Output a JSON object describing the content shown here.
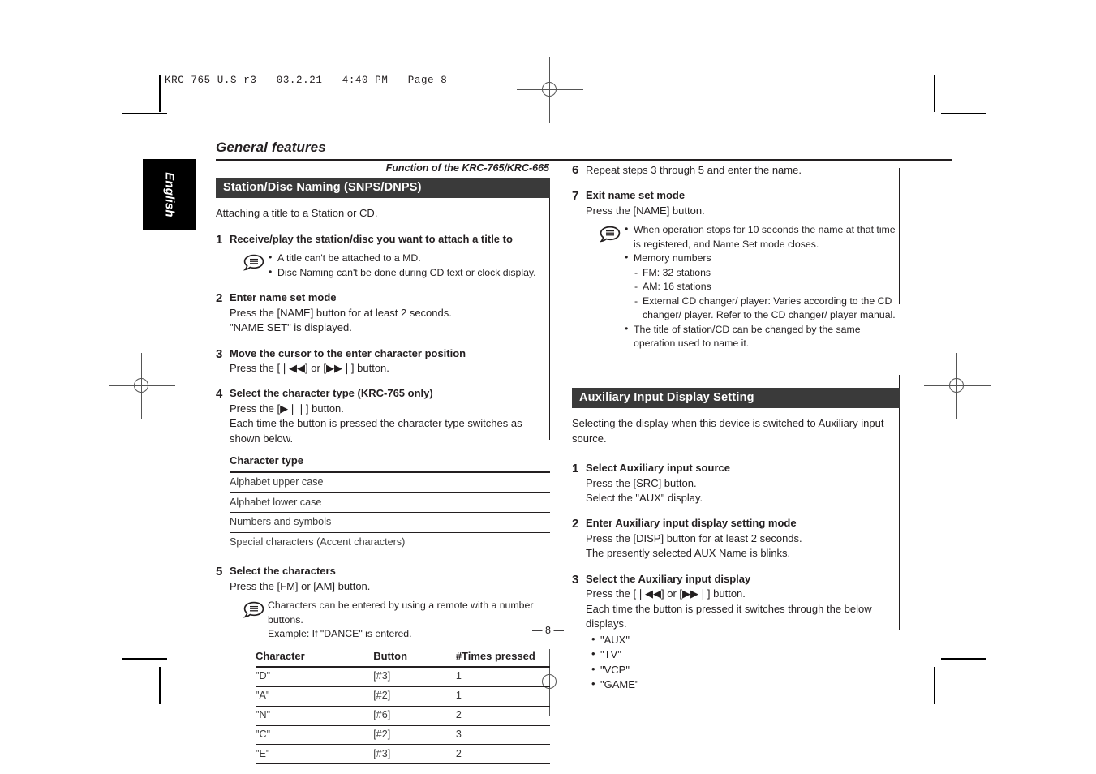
{
  "print_header": "KRC-765_U.S_r3   03.2.21   4:40 PM   Page 8",
  "side_tab": {
    "label": "English"
  },
  "doc_title": "General features",
  "function_note": "Function of the KRC-765/KRC-665",
  "page_number": "— 8 —",
  "icons": {
    "note": "note-speech-bubble-icon"
  },
  "section_naming": {
    "heading": "Station/Disc Naming (SNPS/DNPS)",
    "lead": "Attaching a title to a Station or CD.",
    "steps": [
      {
        "num": "1",
        "heading": "Receive/play the station/disc you want to attach a title to",
        "lines": [],
        "note_bullets": [
          "A title can't be attached to a MD.",
          "Disc Naming can't be done during CD text or clock display."
        ]
      },
      {
        "num": "2",
        "heading": "Enter name set mode",
        "lines": [
          "Press the [NAME] button for at least 2 seconds.",
          "\"NAME SET\" is displayed."
        ]
      },
      {
        "num": "3",
        "heading": "Move the cursor to the enter character position",
        "lines": [
          "Press the [❘◀◀] or [▶▶❘] button."
        ]
      },
      {
        "num": "4",
        "heading": "Select the character type (KRC-765 only)",
        "lines": [
          "Press the [▶❘❘] button.",
          "Each time the button is pressed the character type switches as shown below."
        ]
      },
      {
        "num": "5",
        "heading": "Select the characters",
        "lines": [
          "Press the [FM] or [AM] button."
        ],
        "note_lines": [
          "Characters can be entered by using a remote with a number buttons.",
          "Example: If \"DANCE\" is entered."
        ]
      },
      {
        "num": "6",
        "heading": "",
        "plain": "Repeat steps 3 through 5 and enter the name."
      },
      {
        "num": "7",
        "heading": "Exit name set mode",
        "lines": [
          "Press the [NAME] button."
        ]
      }
    ],
    "character_type_table": {
      "header": "Character type",
      "rows": [
        "Alphabet upper case",
        "Alphabet lower case",
        "Numbers and symbols",
        "Special characters (Accent characters)"
      ]
    },
    "character_table": {
      "headers": [
        "Character",
        "Button",
        "#Times pressed"
      ],
      "rows": [
        [
          "\"D\"",
          "[#3]",
          "1"
        ],
        [
          "\"A\"",
          "[#2]",
          "1"
        ],
        [
          "\"N\"",
          "[#6]",
          "2"
        ],
        [
          "\"C\"",
          "[#2]",
          "3"
        ],
        [
          "\"E\"",
          "[#3]",
          "2"
        ]
      ]
    },
    "step7_note": {
      "b1": "When operation stops for 10 seconds the name at that time is registered, and Name Set mode closes.",
      "b2": "Memory numbers",
      "s1": "FM: 32 stations",
      "s2": "AM: 16 stations",
      "s3": "External CD changer/ player: Varies according to the CD changer/ player. Refer to the CD changer/ player manual.",
      "b3": "The title of station/CD can be changed by the same operation used to name it."
    }
  },
  "section_aux": {
    "heading": "Auxiliary Input Display Setting",
    "lead": "Selecting the display when this device is switched to Auxiliary input source.",
    "steps": [
      {
        "num": "1",
        "heading": "Select Auxiliary input source",
        "l1": "Press the [SRC] button.",
        "l2": "Select the \"AUX\" display."
      },
      {
        "num": "2",
        "heading": "Enter Auxiliary input display setting mode",
        "l1": "Press the [DISP] button for at least 2 seconds.",
        "l2": "The presently selected AUX Name is blinks."
      },
      {
        "num": "3",
        "heading": "Select the Auxiliary input display",
        "l1": "Press the [❘◀◀] or [▶▶❘] button.",
        "l2": "Each time the button is pressed it switches through the below displays."
      }
    ],
    "display_options": [
      "\"AUX\"",
      "\"TV\"",
      "\"VCP\"",
      "\"GAME\""
    ]
  }
}
